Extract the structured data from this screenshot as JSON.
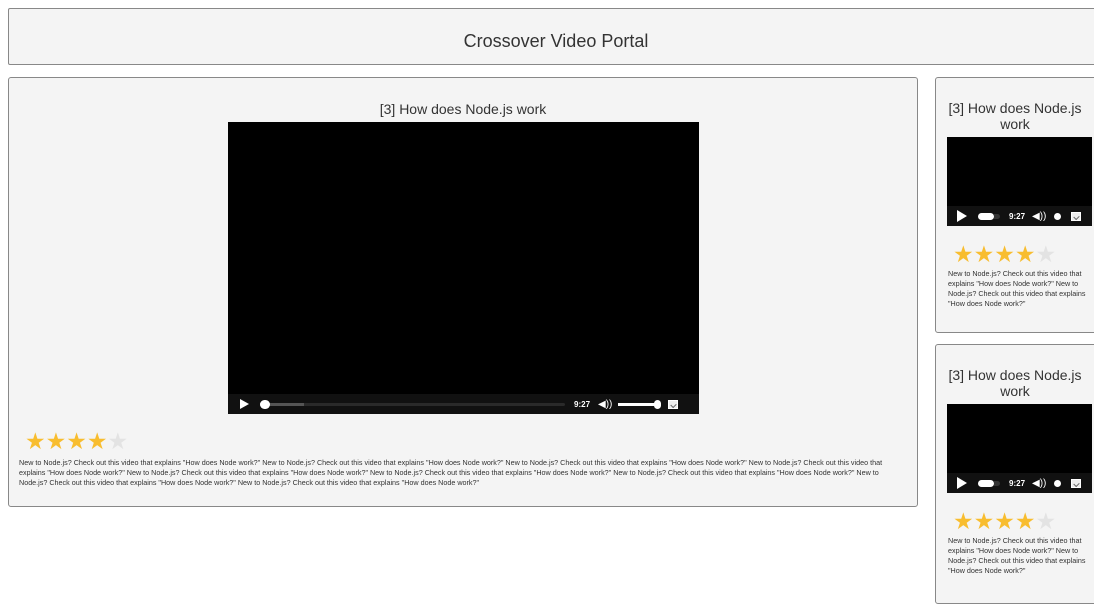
{
  "header": {
    "title": "Crossover Video Portal"
  },
  "main": {
    "title": "[3] How does Node.js work",
    "player": {
      "time": "9:27",
      "progress": 0.0,
      "buffered": 0.14,
      "volume": 1.0
    },
    "rating": 4,
    "rating_max": 5,
    "description": "New to Node.js? Check out this video that explains \"How does Node work?\" New to Node.js? Check out this video that explains \"How does Node work?\" New to Node.js? Check out this video that explains \"How does Node work?\" New to Node.js? Check out this video that explains \"How does Node work?\" New to Node.js? Check out this video that explains \"How does Node work?\" New to Node.js? Check out this video that explains \"How does Node work?\" New to Node.js? Check out this video that explains \"How does Node work?\" New to Node.js? Check out this video that explains \"How does Node work?\" New to Node.js? Check out this video that explains \"How does Node work?\""
  },
  "sidebar": {
    "videos": [
      {
        "title": "[3] How does Node.js work",
        "time": "9:27",
        "rating": 4,
        "description": "New to Node.js? Check out this video that explains \"How does Node work?\" New to Node.js? Check out this video that explains \"How does Node work?\""
      },
      {
        "title": "[3] How does Node.js work",
        "time": "9:27",
        "rating": 4,
        "description": "New to Node.js? Check out this video that explains \"How does Node work?\" New to Node.js? Check out this video that explains \"How does Node work?\""
      }
    ]
  },
  "colors": {
    "star_on": "#f8bd2f",
    "star_off": "#e3e3e3",
    "panel_bg": "#f4f4f4"
  },
  "icons": [
    "play-icon",
    "volume-icon",
    "fullscreen-icon",
    "star-icon"
  ]
}
